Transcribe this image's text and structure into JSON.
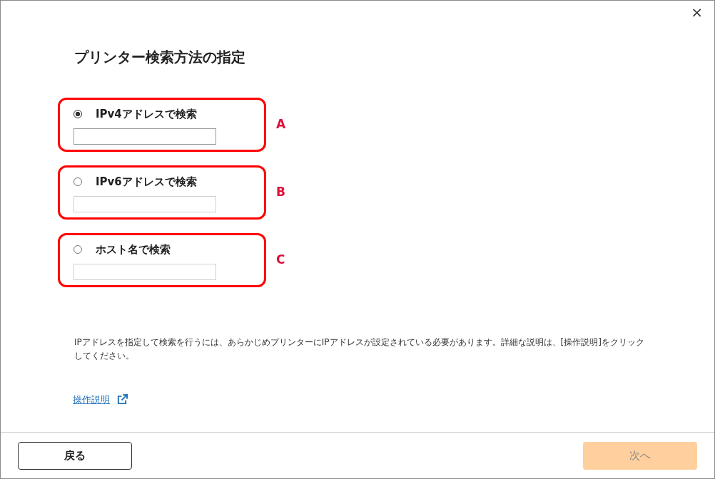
{
  "window": {
    "close": "×"
  },
  "title": "プリンター検索方法の指定",
  "options": [
    {
      "label": "IPv4アドレスで検索",
      "selected": true,
      "field_disabled": false,
      "marker": "A"
    },
    {
      "label": "IPv6アドレスで検索",
      "selected": false,
      "field_disabled": true,
      "marker": "B"
    },
    {
      "label": "ホスト名で検索",
      "selected": false,
      "field_disabled": true,
      "marker": "C"
    }
  ],
  "note": "IPアドレスを指定して検索を行うには、あらかじめプリンターにIPアドレスが設定されている必要があります。詳細な説明は、[操作説明]をクリックしてください。",
  "help_link": "操作説明",
  "buttons": [
    {
      "label": "戻る",
      "disabled": false
    },
    {
      "label": "次へ",
      "disabled": true
    }
  ]
}
